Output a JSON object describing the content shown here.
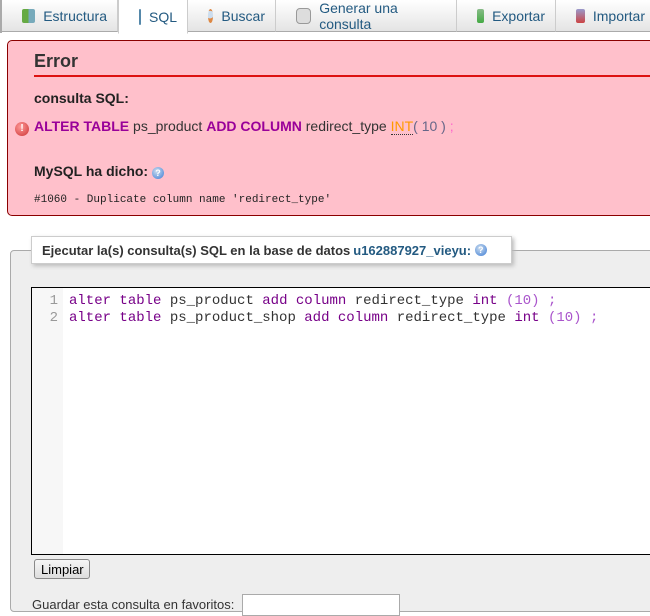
{
  "tabs": [
    {
      "label": "Estructura",
      "icon": "structure-icon"
    },
    {
      "label": "SQL",
      "icon": "sql-icon",
      "active": true
    },
    {
      "label": "Buscar",
      "icon": "search-icon"
    },
    {
      "label": "Generar una consulta",
      "icon": "query-icon"
    },
    {
      "label": "Exportar",
      "icon": "export-icon"
    },
    {
      "label": "Importar",
      "icon": "import-icon"
    }
  ],
  "error": {
    "title": "Error",
    "query_label": "consulta SQL:",
    "query": {
      "kw1": "ALTER TABLE",
      "t1": " ps_product ",
      "kw2": "ADD COLUMN",
      "t2": " redirect_type ",
      "type": "INT",
      "args": "( 10 )",
      "end": " ;"
    },
    "mysql_label": "MySQL ha dicho:",
    "message": "#1060 - Duplicate column name 'redirect_type'"
  },
  "sql_box": {
    "legend": "Ejecutar la(s) consulta(s) SQL en la base de datos ",
    "db": "u162887927_vieyu:",
    "lines": [
      {
        "n": "1",
        "a": "alter",
        "b": "table",
        "c": " ps_product ",
        "d": "add",
        "e": "column",
        "f": " redirect_type ",
        "g": "int",
        "h": "(10)",
        "i": ";"
      },
      {
        "n": "2",
        "a": "alter",
        "b": "table",
        "c": " ps_product_shop ",
        "d": "add",
        "e": "column",
        "f": " redirect_type ",
        "g": "int",
        "h": "(10)",
        "i": ";"
      }
    ]
  },
  "clear_label": "Limpiar",
  "bookmark_label": "Guardar esta consulta en favoritos:",
  "colors": {
    "error_bg": "#ffc0cb",
    "keyword": "#990099"
  }
}
